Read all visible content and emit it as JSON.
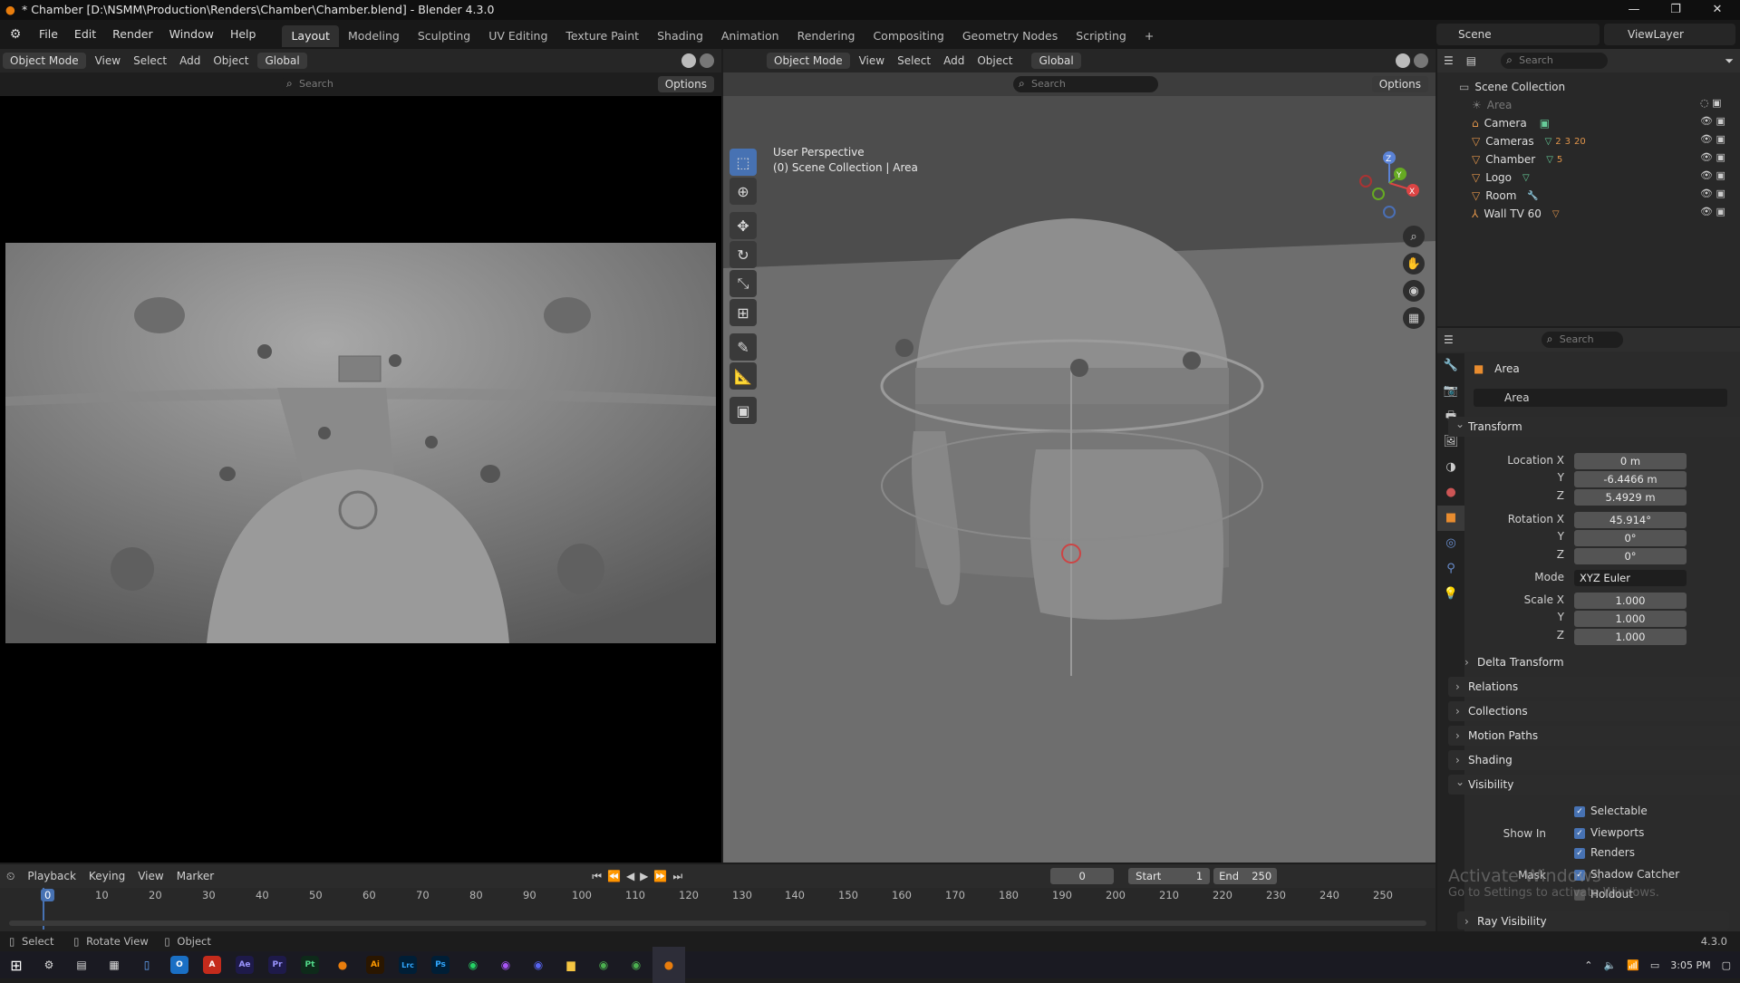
{
  "window": {
    "title": "* Chamber [D:\\NSMM\\Production\\Renders\\Chamber\\Chamber.blend] - Blender 4.3.0"
  },
  "menu": [
    "File",
    "Edit",
    "Render",
    "Window",
    "Help"
  ],
  "workspaces": [
    "Layout",
    "Modeling",
    "Sculpting",
    "UV Editing",
    "Texture Paint",
    "Shading",
    "Animation",
    "Rendering",
    "Compositing",
    "Geometry Nodes",
    "Scripting"
  ],
  "scene": {
    "scene_name": "Scene",
    "view_layer": "ViewLayer"
  },
  "left_viewport": {
    "mode": "Object Mode",
    "menus": [
      "View",
      "Select",
      "Add",
      "Object"
    ],
    "orientation": "Global",
    "search_placeholder": "Search",
    "options": "Options"
  },
  "right_viewport": {
    "mode": "Object Mode",
    "menus": [
      "View",
      "Select",
      "Add",
      "Object"
    ],
    "orientation": "Global",
    "search_placeholder": "Search",
    "options": "Options",
    "info_line1": "User Perspective",
    "info_line2": "(0) Scene Collection | Area",
    "gizmo": {
      "z": "Z",
      "y": "Y",
      "x": "X"
    }
  },
  "outliner": {
    "search_placeholder": "Search",
    "root": "Scene Collection",
    "items": [
      {
        "name": "Area",
        "dim": true
      },
      {
        "name": "Camera"
      },
      {
        "name": "Cameras",
        "badge1": "2",
        "badge2": "3",
        "badge3": "20"
      },
      {
        "name": "Chamber",
        "badge1": "5"
      },
      {
        "name": "Logo"
      },
      {
        "name": "Room"
      },
      {
        "name": "Wall TV 60"
      }
    ]
  },
  "properties": {
    "search_placeholder": "Search",
    "object_name": "Area",
    "data_name": "Area",
    "transform_title": "Transform",
    "location": {
      "label": "Location X",
      "x": "0 m",
      "y": "-6.4466 m",
      "z": "5.4929 m"
    },
    "rotation": {
      "label": "Rotation X",
      "x": "45.914°",
      "y": "0°",
      "z": "0°"
    },
    "mode_label": "Mode",
    "mode_value": "XYZ Euler",
    "scale": {
      "label": "Scale X",
      "x": "1.000",
      "y": "1.000",
      "z": "1.000"
    },
    "axis": {
      "y": "Y",
      "z": "Z"
    },
    "sections": [
      "Delta Transform",
      "Relations",
      "Collections",
      "Motion Paths",
      "Shading"
    ],
    "visibility_title": "Visibility",
    "selectable": "Selectable",
    "show_in": "Show In",
    "viewports": "Viewports",
    "renders": "Renders",
    "mask": "Mask",
    "shadow_catcher": "Shadow Catcher",
    "holdout": "Holdout",
    "ray_visibility": "Ray Visibility"
  },
  "timeline": {
    "menus": [
      "Playback",
      "Keying",
      "View",
      "Marker"
    ],
    "current_frame": "0",
    "start_label": "Start",
    "start": "1",
    "end_label": "End",
    "end": "250",
    "ticks": [
      "0",
      "10",
      "20",
      "30",
      "40",
      "50",
      "60",
      "70",
      "80",
      "90",
      "100",
      "110",
      "120",
      "130",
      "140",
      "150",
      "160",
      "170",
      "180",
      "190",
      "200",
      "210",
      "220",
      "230",
      "240",
      "250"
    ]
  },
  "statusbar": {
    "select": "Select",
    "rotate": "Rotate View",
    "object": "Object",
    "version": "4.3.0"
  },
  "watermark": {
    "line1": "Activate Windows",
    "line2": "Go to Settings to activate Windows."
  },
  "taskbar": {
    "time": "3:05 PM",
    "apps": [
      "Ae",
      "Pr",
      "Pt",
      "Ai",
      "Lrc",
      "Ps"
    ]
  }
}
